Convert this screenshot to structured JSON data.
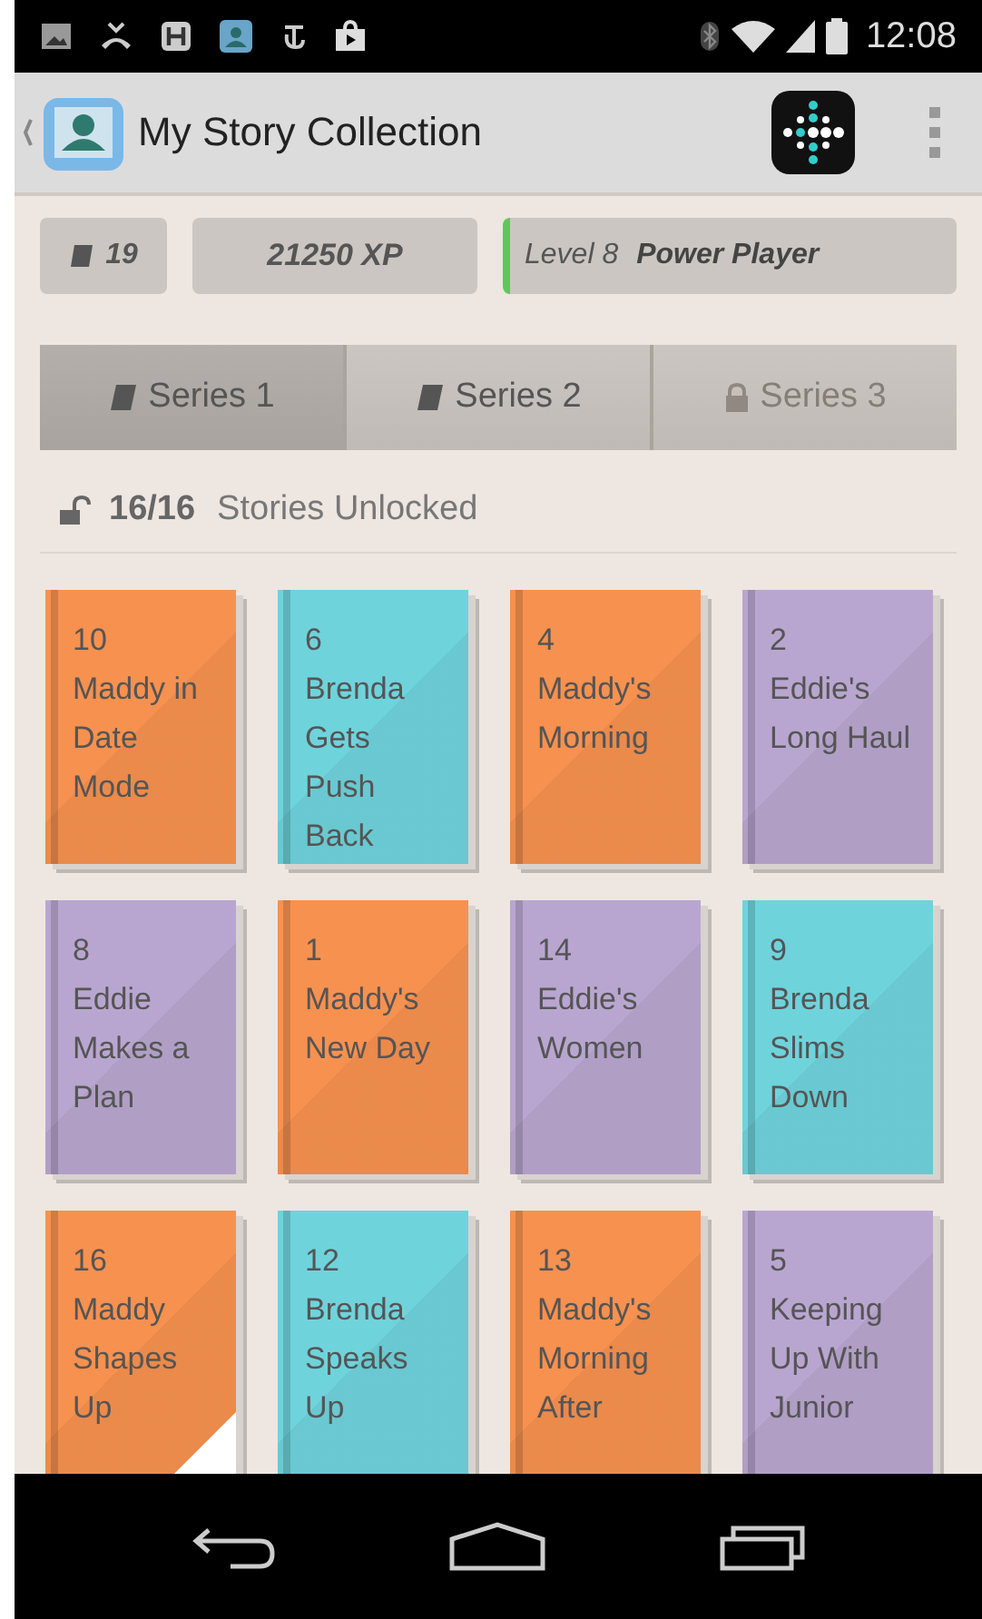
{
  "status_bar": {
    "time": "12:08"
  },
  "app_bar": {
    "title": "My Story Collection"
  },
  "stats": {
    "books": "19",
    "xp": "21250 XP",
    "level": "Level 8",
    "rank": "Power Player"
  },
  "tabs": [
    {
      "label": "Series 1",
      "selected": true,
      "locked": false
    },
    {
      "label": "Series 2",
      "selected": false,
      "locked": false
    },
    {
      "label": "Series 3",
      "selected": false,
      "locked": true
    }
  ],
  "unlocked": {
    "count": "16/16",
    "label": "Stories Unlocked"
  },
  "stories": [
    {
      "number": "10",
      "title": "Maddy in Date Mode",
      "color": "#f7914f",
      "new": false
    },
    {
      "number": "6",
      "title": "Brenda Gets Push Back",
      "color": "#6fd3dc",
      "new": false
    },
    {
      "number": "4",
      "title": "Maddy's Morning",
      "color": "#f7914f",
      "new": false
    },
    {
      "number": "2",
      "title": "Eddie's Long Haul",
      "color": "#b9a6d0",
      "new": false
    },
    {
      "number": "8",
      "title": "Eddie Makes a Plan",
      "color": "#b9a6d0",
      "new": false
    },
    {
      "number": "1",
      "title": "Maddy's New Day",
      "color": "#f7914f",
      "new": false
    },
    {
      "number": "14",
      "title": "Eddie's Women",
      "color": "#b9a6d0",
      "new": false
    },
    {
      "number": "9",
      "title": "Brenda Slims Down",
      "color": "#6fd3dc",
      "new": false
    },
    {
      "number": "16",
      "title": "Maddy Shapes Up",
      "color": "#f7914f",
      "new": true
    },
    {
      "number": "12",
      "title": "Brenda Speaks Up",
      "color": "#6fd3dc",
      "new": false
    },
    {
      "number": "13",
      "title": "Maddy's Morning After",
      "color": "#f7914f",
      "new": false
    },
    {
      "number": "5",
      "title": "Keeping Up With Junior",
      "color": "#b9a6d0",
      "new": false
    }
  ]
}
